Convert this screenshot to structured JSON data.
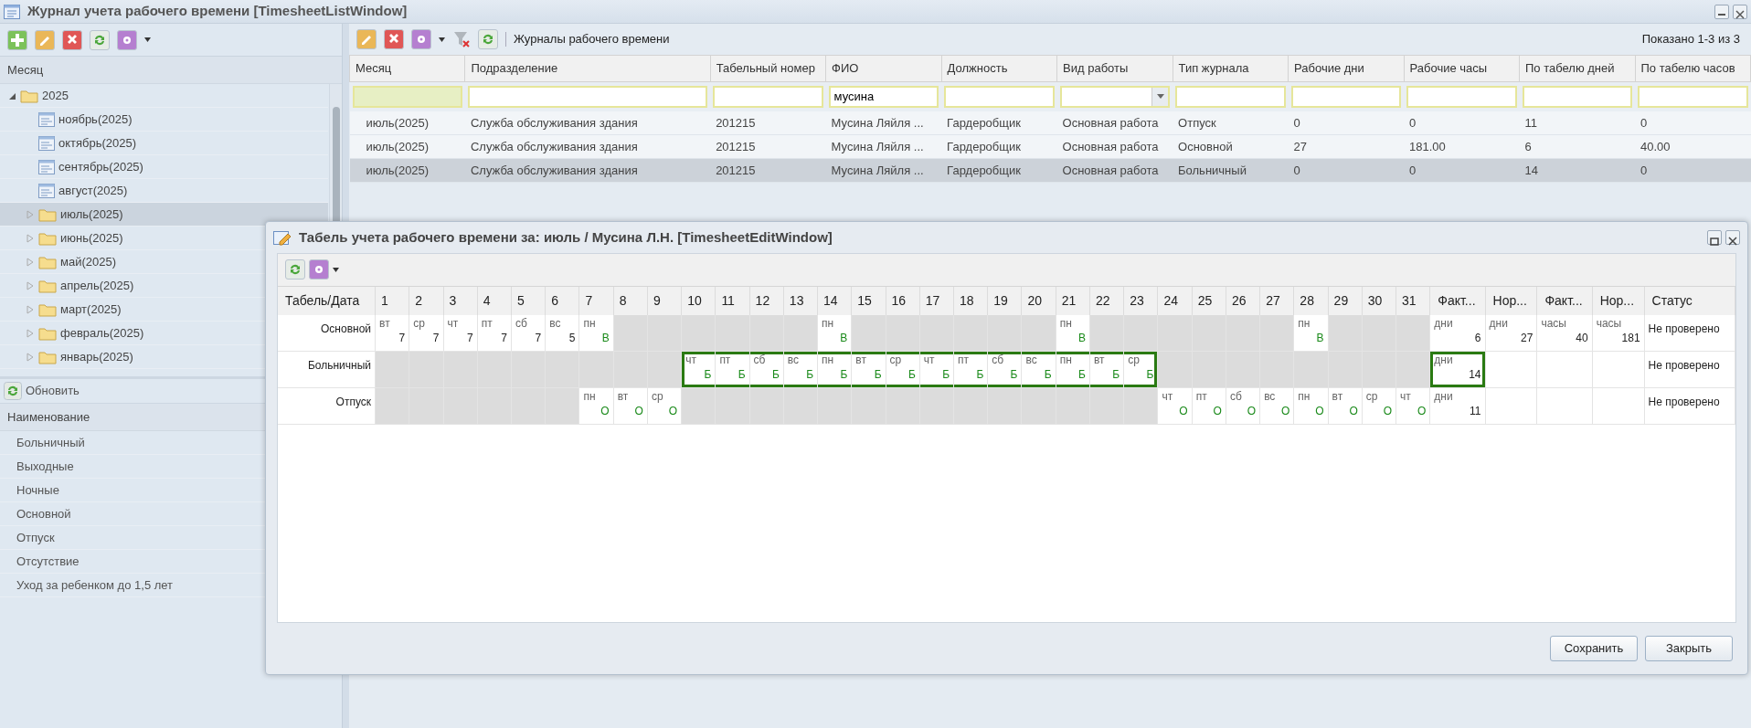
{
  "main_window": {
    "title": "Журнал учета рабочего времени [TimesheetListWindow]"
  },
  "month_panel": {
    "header": "Месяц",
    "tree": [
      {
        "label": "2025",
        "kind": "folder",
        "expanded": true,
        "selected": false,
        "children": [
          {
            "label": "ноябрь(2025)",
            "kind": "document",
            "selected": false
          },
          {
            "label": "октябрь(2025)",
            "kind": "document",
            "selected": false
          },
          {
            "label": "сентябрь(2025)",
            "kind": "document",
            "selected": false
          },
          {
            "label": "август(2025)",
            "kind": "document",
            "selected": false
          },
          {
            "label": "июль(2025)",
            "kind": "folder",
            "expanded": false,
            "selected": true
          },
          {
            "label": "июнь(2025)",
            "kind": "folder",
            "expanded": false,
            "selected": false
          },
          {
            "label": "май(2025)",
            "kind": "folder",
            "expanded": false,
            "selected": false
          },
          {
            "label": "апрель(2025)",
            "kind": "folder",
            "expanded": false,
            "selected": false
          },
          {
            "label": "март(2025)",
            "kind": "folder",
            "expanded": false,
            "selected": false
          },
          {
            "label": "февраль(2025)",
            "kind": "folder",
            "expanded": false,
            "selected": false
          },
          {
            "label": "январь(2025)",
            "kind": "folder",
            "expanded": false,
            "selected": false
          }
        ]
      }
    ]
  },
  "types_panel": {
    "refresh_button": "Обновить",
    "header": "Наименование",
    "items": [
      "Больничный",
      "Выходные",
      "Ночные",
      "Основной",
      "Отпуск",
      "Отсутствие",
      "Уход за ребенком до 1,5 лет"
    ]
  },
  "journals": {
    "title": "Журналы рабочего времени",
    "paging": "Показано 1-3 из 3",
    "columns": [
      "Месяц",
      "Подразделение",
      "Табельный номер",
      "ФИО",
      "Должность",
      "Вид работы",
      "Тип журнала",
      "Рабочие дни",
      "Рабочие часы",
      "По табелю дней",
      "По табелю часов"
    ],
    "filters": [
      {
        "kind": "text",
        "focused": true
      },
      {
        "kind": "text",
        "focused": false
      },
      {
        "kind": "text",
        "focused": false
      },
      {
        "kind": "text",
        "value": "мусина",
        "focused": false
      },
      {
        "kind": "text",
        "focused": false
      },
      {
        "kind": "select",
        "focused": false
      },
      {
        "kind": "text",
        "focused": false
      },
      {
        "kind": "text",
        "focused": false
      },
      {
        "kind": "text",
        "focused": false
      },
      {
        "kind": "text",
        "focused": false
      },
      {
        "kind": "text",
        "focused": false
      }
    ],
    "rows": [
      {
        "selected": false,
        "cells": [
          "июль(2025)",
          "Служба обслуживания здания",
          "201215",
          "Мусина Ляйля ...",
          "Гардеробщик",
          "Основная работа",
          "Отпуск",
          "0",
          "0",
          "11",
          "0"
        ]
      },
      {
        "selected": false,
        "cells": [
          "июль(2025)",
          "Служба обслуживания здания",
          "201215",
          "Мусина Ляйля ...",
          "Гардеробщик",
          "Основная работа",
          "Основной",
          "27",
          "181.00",
          "6",
          "40.00"
        ]
      },
      {
        "selected": true,
        "cells": [
          "июль(2025)",
          "Служба обслуживания здания",
          "201215",
          "Мусина Ляйля ...",
          "Гардеробщик",
          "Основная работа",
          "Больничный",
          "0",
          "0",
          "14",
          "0"
        ]
      }
    ]
  },
  "dialog": {
    "title": "Табель учета рабочего времени за: июль / Мусина Л.Н. [TimesheetEditWindow]",
    "columns": [
      "Табель/Дата",
      "1",
      "2",
      "3",
      "4",
      "5",
      "6",
      "7",
      "8",
      "9",
      "10",
      "11",
      "12",
      "13",
      "14",
      "15",
      "16",
      "17",
      "18",
      "19",
      "20",
      "21",
      "22",
      "23",
      "24",
      "25",
      "26",
      "27",
      "28",
      "29",
      "30",
      "31",
      "Факт...",
      "Нор...",
      "Факт...",
      "Нор...",
      "Статус"
    ],
    "rows": [
      {
        "label": "Основной",
        "status": "Не проверено",
        "days": [
          {
            "kind": "hours",
            "weekday": "вт",
            "value": "7",
            "highlighted": false
          },
          {
            "kind": "hours",
            "weekday": "ср",
            "value": "7",
            "highlighted": false
          },
          {
            "kind": "hours",
            "weekday": "чт",
            "value": "7",
            "highlighted": false
          },
          {
            "kind": "hours",
            "weekday": "пт",
            "value": "7",
            "highlighted": false
          },
          {
            "kind": "hours",
            "weekday": "сб",
            "value": "7",
            "highlighted": false
          },
          {
            "kind": "hours",
            "weekday": "вс",
            "value": "5",
            "highlighted": false
          },
          {
            "kind": "code",
            "weekday": "пн",
            "value": "В",
            "highlighted": false
          },
          {
            "kind": "off",
            "highlighted": false
          },
          {
            "kind": "off",
            "highlighted": false
          },
          {
            "kind": "off",
            "highlighted": false
          },
          {
            "kind": "off",
            "highlighted": false
          },
          {
            "kind": "off",
            "highlighted": false
          },
          {
            "kind": "off",
            "highlighted": false
          },
          {
            "kind": "code",
            "weekday": "пн",
            "value": "В",
            "highlighted": false
          },
          {
            "kind": "off",
            "highlighted": false
          },
          {
            "kind": "off",
            "highlighted": false
          },
          {
            "kind": "off",
            "highlighted": false
          },
          {
            "kind": "off",
            "highlighted": false
          },
          {
            "kind": "off",
            "highlighted": false
          },
          {
            "kind": "off",
            "highlighted": false
          },
          {
            "kind": "code",
            "weekday": "пн",
            "value": "В",
            "highlighted": false
          },
          {
            "kind": "off",
            "highlighted": false
          },
          {
            "kind": "off",
            "highlighted": false
          },
          {
            "kind": "off",
            "highlighted": false
          },
          {
            "kind": "off",
            "highlighted": false
          },
          {
            "kind": "off",
            "highlighted": false
          },
          {
            "kind": "off",
            "highlighted": false
          },
          {
            "kind": "code",
            "weekday": "пн",
            "value": "В",
            "highlighted": false
          },
          {
            "kind": "off",
            "highlighted": false
          },
          {
            "kind": "off",
            "highlighted": false
          },
          {
            "kind": "off",
            "highlighted": false
          }
        ],
        "totals": {
          "fact_days": {
            "unit": "дни",
            "value": "6",
            "highlighted": false
          },
          "norm_days": {
            "unit": "дни",
            "value": "27",
            "highlighted": false
          },
          "fact_hours": {
            "unit": "часы",
            "value": "40",
            "highlighted": false
          },
          "norm_hours": {
            "unit": "часы",
            "value": "181",
            "highlighted": false
          }
        }
      },
      {
        "label": "Больничный",
        "status": "Не проверено",
        "days": [
          {
            "kind": "off",
            "highlighted": false
          },
          {
            "kind": "off",
            "highlighted": false
          },
          {
            "kind": "off",
            "highlighted": false
          },
          {
            "kind": "off",
            "highlighted": false
          },
          {
            "kind": "off",
            "highlighted": false
          },
          {
            "kind": "off",
            "highlighted": false
          },
          {
            "kind": "off",
            "highlighted": false
          },
          {
            "kind": "off",
            "highlighted": false
          },
          {
            "kind": "off",
            "highlighted": false
          },
          {
            "kind": "code",
            "weekday": "чт",
            "value": "Б",
            "highlighted": true
          },
          {
            "kind": "code",
            "weekday": "пт",
            "value": "Б",
            "highlighted": true
          },
          {
            "kind": "code",
            "weekday": "сб",
            "value": "Б",
            "highlighted": true
          },
          {
            "kind": "code",
            "weekday": "вс",
            "value": "Б",
            "highlighted": true
          },
          {
            "kind": "code",
            "weekday": "пн",
            "value": "Б",
            "highlighted": true
          },
          {
            "kind": "code",
            "weekday": "вт",
            "value": "Б",
            "highlighted": true
          },
          {
            "kind": "code",
            "weekday": "ср",
            "value": "Б",
            "highlighted": true
          },
          {
            "kind": "code",
            "weekday": "чт",
            "value": "Б",
            "highlighted": true
          },
          {
            "kind": "code",
            "weekday": "пт",
            "value": "Б",
            "highlighted": true
          },
          {
            "kind": "code",
            "weekday": "сб",
            "value": "Б",
            "highlighted": true
          },
          {
            "kind": "code",
            "weekday": "вс",
            "value": "Б",
            "highlighted": true
          },
          {
            "kind": "code",
            "weekday": "пн",
            "value": "Б",
            "highlighted": true
          },
          {
            "kind": "code",
            "weekday": "вт",
            "value": "Б",
            "highlighted": true
          },
          {
            "kind": "code",
            "weekday": "ср",
            "value": "Б",
            "highlighted": true
          },
          {
            "kind": "off",
            "highlighted": false
          },
          {
            "kind": "off",
            "highlighted": false
          },
          {
            "kind": "off",
            "highlighted": false
          },
          {
            "kind": "off",
            "highlighted": false
          },
          {
            "kind": "off",
            "highlighted": false
          },
          {
            "kind": "off",
            "highlighted": false
          },
          {
            "kind": "off",
            "highlighted": false
          },
          {
            "kind": "off",
            "highlighted": false
          }
        ],
        "totals": {
          "fact_days": {
            "unit": "дни",
            "value": "14",
            "highlighted": true
          }
        }
      },
      {
        "label": "Отпуск",
        "status": "Не проверено",
        "days": [
          {
            "kind": "off",
            "highlighted": false
          },
          {
            "kind": "off",
            "highlighted": false
          },
          {
            "kind": "off",
            "highlighted": false
          },
          {
            "kind": "off",
            "highlighted": false
          },
          {
            "kind": "off",
            "highlighted": false
          },
          {
            "kind": "off",
            "highlighted": false
          },
          {
            "kind": "code",
            "weekday": "пн",
            "value": "О",
            "highlighted": false
          },
          {
            "kind": "code",
            "weekday": "вт",
            "value": "О",
            "highlighted": false
          },
          {
            "kind": "code",
            "weekday": "ср",
            "value": "О",
            "highlighted": false
          },
          {
            "kind": "off",
            "highlighted": false
          },
          {
            "kind": "off",
            "highlighted": false
          },
          {
            "kind": "off",
            "highlighted": false
          },
          {
            "kind": "off",
            "highlighted": false
          },
          {
            "kind": "off",
            "highlighted": false
          },
          {
            "kind": "off",
            "highlighted": false
          },
          {
            "kind": "off",
            "highlighted": false
          },
          {
            "kind": "off",
            "highlighted": false
          },
          {
            "kind": "off",
            "highlighted": false
          },
          {
            "kind": "off",
            "highlighted": false
          },
          {
            "kind": "off",
            "highlighted": false
          },
          {
            "kind": "off",
            "highlighted": false
          },
          {
            "kind": "off",
            "highlighted": false
          },
          {
            "kind": "off",
            "highlighted": false
          },
          {
            "kind": "code",
            "weekday": "чт",
            "value": "О",
            "highlighted": false
          },
          {
            "kind": "code",
            "weekday": "пт",
            "value": "О",
            "highlighted": false
          },
          {
            "kind": "code",
            "weekday": "сб",
            "value": "О",
            "highlighted": false
          },
          {
            "kind": "code",
            "weekday": "вс",
            "value": "О",
            "highlighted": false
          },
          {
            "kind": "code",
            "weekday": "пн",
            "value": "О",
            "highlighted": false
          },
          {
            "kind": "code",
            "weekday": "вт",
            "value": "О",
            "highlighted": false
          },
          {
            "kind": "code",
            "weekday": "ср",
            "value": "О",
            "highlighted": false
          },
          {
            "kind": "code",
            "weekday": "чт",
            "value": "О",
            "highlighted": false
          }
        ],
        "totals": {
          "fact_days": {
            "unit": "дни",
            "value": "11",
            "highlighted": false
          }
        }
      }
    ],
    "buttons": [
      "Сохранить",
      "Закрыть"
    ]
  }
}
